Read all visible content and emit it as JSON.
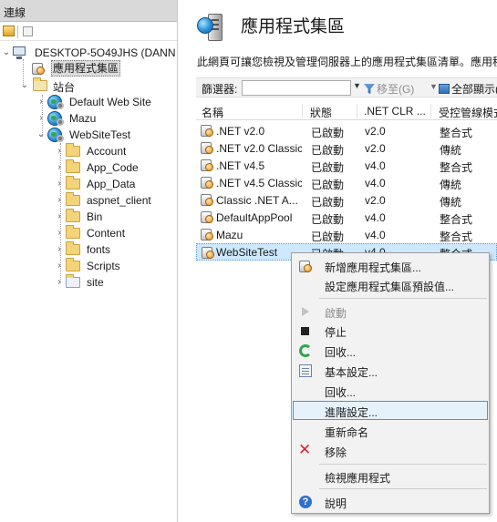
{
  "left_pane": {
    "header": "連線",
    "tree": {
      "server": "DESKTOP-5O49JHS (DANN",
      "app_pools": "應用程式集區",
      "sites": "站台",
      "site_items": [
        "Default Web Site",
        "Mazu",
        "WebSiteTest"
      ],
      "folders": [
        "Account",
        "App_Code",
        "App_Data",
        "aspnet_client",
        "Bin",
        "Content",
        "fonts",
        "Scripts",
        "site"
      ]
    }
  },
  "main": {
    "title": "應用程式集區",
    "description": "此網頁可讓您檢視及管理伺服器上的應用程式集區清單。應用程",
    "filter": {
      "label": "篩選器:",
      "value": "",
      "go": "移至(G)",
      "show_all": "全部顯示(A"
    },
    "columns": [
      "名稱",
      "狀態",
      ".NET CLR ...",
      "受控管線模式"
    ],
    "rows": [
      {
        "name": ".NET v2.0",
        "status": "已啟動",
        "clr": "v2.0",
        "mode": "整合式"
      },
      {
        "name": ".NET v2.0 Classic",
        "status": "已啟動",
        "clr": "v2.0",
        "mode": "傳統"
      },
      {
        "name": ".NET v4.5",
        "status": "已啟動",
        "clr": "v4.0",
        "mode": "整合式"
      },
      {
        "name": ".NET v4.5 Classic",
        "status": "已啟動",
        "clr": "v4.0",
        "mode": "傳統"
      },
      {
        "name": "Classic .NET A...",
        "status": "已啟動",
        "clr": "v2.0",
        "mode": "傳統"
      },
      {
        "name": "DefaultAppPool",
        "status": "已啟動",
        "clr": "v4.0",
        "mode": "整合式"
      },
      {
        "name": "Mazu",
        "status": "已啟動",
        "clr": "v4.0",
        "mode": "整合式"
      },
      {
        "name": "WebSiteTest",
        "status": "已啟動",
        "clr": "v4.0",
        "mode": "整合式"
      }
    ]
  },
  "context_menu": {
    "add_pool": "新增應用程式集區...",
    "set_defaults": "設定應用程式集區預設值...",
    "start": "啟動",
    "stop": "停止",
    "recycle": "回收...",
    "basic_settings": "基本設定...",
    "recycling": "回收...",
    "advanced_settings": "進階設定...",
    "rename": "重新命名",
    "remove": "移除",
    "view_apps": "檢視應用程式",
    "help": "說明"
  }
}
